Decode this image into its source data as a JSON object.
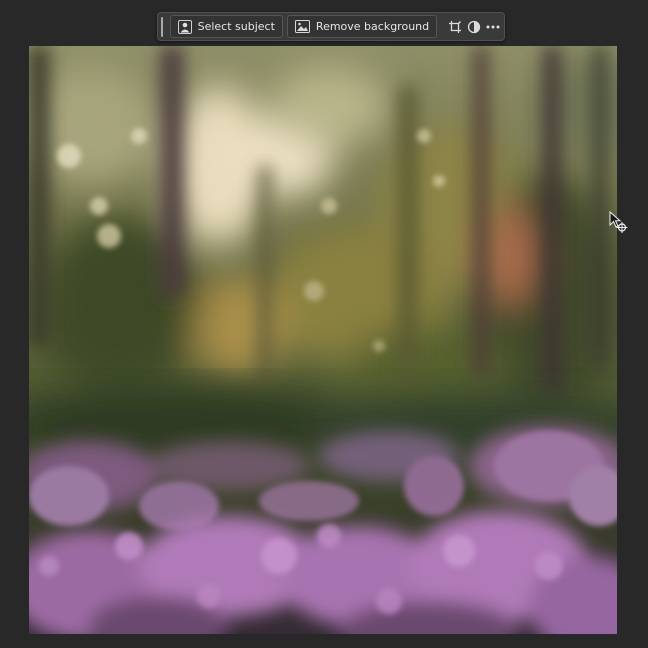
{
  "taskbar": {
    "select_subject_label": "Select subject",
    "remove_background_label": "Remove background",
    "icons": {
      "select_subject": "person-silhouette-icon",
      "remove_background": "image-icon",
      "crop": "crop-icon",
      "adjustment": "half-circle-adjustment-icon",
      "more": "more-horizontal-icon"
    }
  },
  "canvas": {
    "image_description": "blurred forest with pink heather flowers in foreground",
    "colors": {
      "forest_dark": "#2f3a22",
      "forest_mid": "#6b6d3c",
      "highlight": "#e8dcc0",
      "heather": "#b07ab8",
      "heather_dark": "#6b4a6e",
      "background": "#282828"
    }
  },
  "cursor": {
    "icon": "arrow-with-crosshair-cursor-icon"
  }
}
